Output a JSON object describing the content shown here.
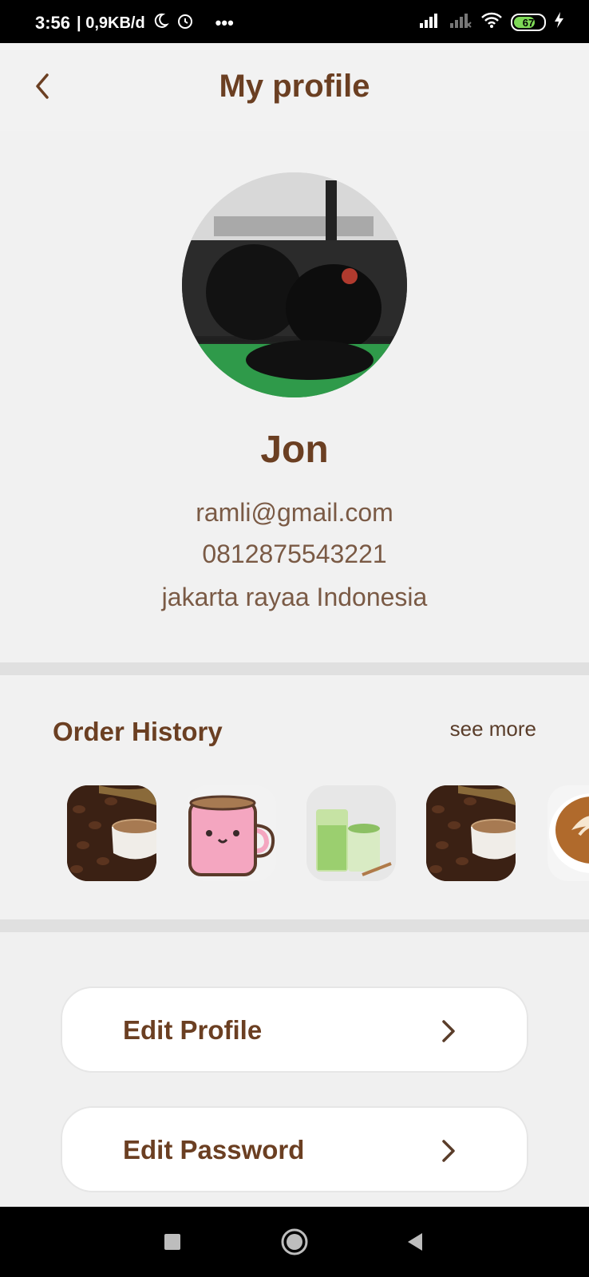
{
  "status": {
    "time": "3:56",
    "speed": "| 0,9KB/d",
    "more": "•••",
    "battery": "67"
  },
  "header": {
    "title": "My profile",
    "back_icon": "chevron-left-icon"
  },
  "profile": {
    "name": "Jon",
    "email": "ramli@gmail.com",
    "phone": "0812875543221",
    "address": "jakarta rayaa Indonesia"
  },
  "orders": {
    "title": "Order History",
    "see_more": "see more",
    "items": [
      {
        "icon": "coffee-beans-cup-image"
      },
      {
        "icon": "pink-mug-image"
      },
      {
        "icon": "matcha-drinks-image"
      },
      {
        "icon": "coffee-beans-cup-image"
      },
      {
        "icon": "latte-art-image"
      }
    ]
  },
  "menu": {
    "edit_profile": "Edit Profile",
    "edit_password": "Edit Password"
  },
  "colors": {
    "brand_brown": "#6b3f22",
    "background": "#f2f2f2"
  }
}
